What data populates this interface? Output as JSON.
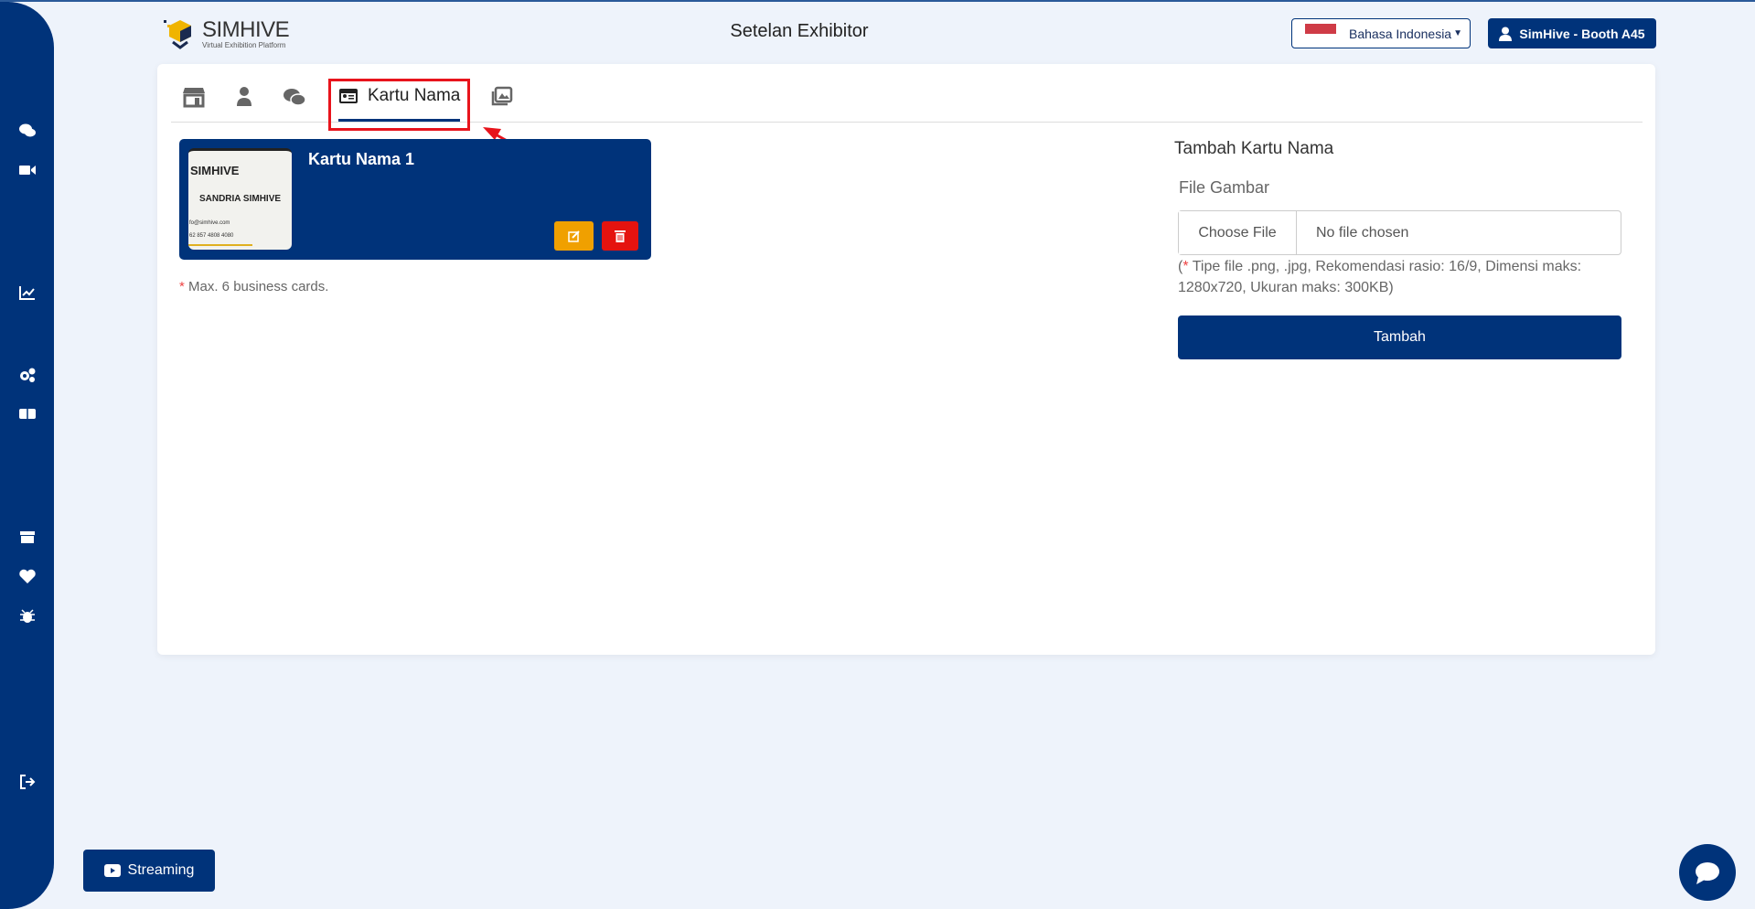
{
  "header": {
    "logo_text": "SIMHIVE",
    "logo_tagline": "Virtual Exhibition Platform",
    "title": "Setelan Exhibitor",
    "language": "Bahasa Indonesia",
    "user": "SimHive - Booth A45"
  },
  "sidebar": {
    "icons": [
      "comments-icon",
      "video-icon",
      "chart-line-icon",
      "cogs-icon",
      "boxes-icon",
      "box-icon",
      "heart-icon",
      "bug-icon",
      "sign-out-icon"
    ]
  },
  "tabs": {
    "icons": [
      "store-icon",
      "user-icon",
      "comments-icon",
      "id-card-icon",
      "images-icon"
    ],
    "active_label": "Kartu Nama"
  },
  "cards": [
    {
      "title": "Kartu Nama 1",
      "thumbnail_name": "SANDRIA SIMHIVE",
      "thumbnail_brand": "SIMHIVE",
      "thumbnail_email": "fo@simhive.com",
      "thumbnail_phone": "62 857 4808 4080"
    }
  ],
  "note": {
    "star": "*",
    "text": " Max. 6 business cards."
  },
  "form": {
    "title": "Tambah Kartu Nama",
    "label": "File Gambar",
    "choose": "Choose File",
    "no_file": "No file chosen",
    "help_star": "*",
    "help_open": "(",
    "help_text": " Tipe file .png, .jpg, Rekomendasi rasio: 16/9, Dimensi maks: 1280x720, Ukuran maks: 300KB)",
    "submit": "Tambah"
  },
  "streaming": "Streaming",
  "colors": {
    "primary": "#00337a",
    "edit": "#f0a000",
    "delete": "#e5130f",
    "highlight": "#e8141c"
  }
}
